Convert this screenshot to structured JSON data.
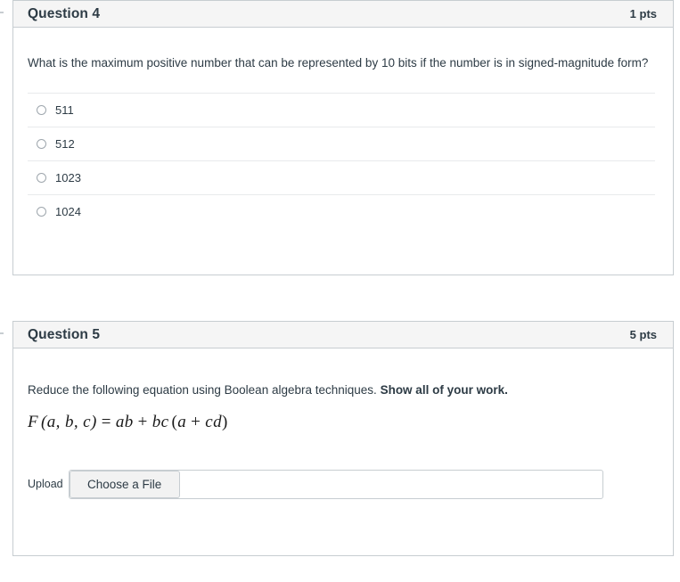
{
  "questions": [
    {
      "title": "Question 4",
      "points": "1 pts",
      "prompt": "What is the maximum positive number that can be represented by 10 bits if the number is in signed-magnitude form?",
      "answers": [
        {
          "label": "511",
          "selected": false
        },
        {
          "label": "512",
          "selected": false
        },
        {
          "label": "1023",
          "selected": false
        },
        {
          "label": "1024",
          "selected": false
        }
      ]
    },
    {
      "title": "Question 5",
      "points": "5 pts",
      "prompt_plain": "Reduce the following equation using Boolean algebra techniques.",
      "prompt_bold": "Show all of your work.",
      "equation": {
        "lhs": "F",
        "args": "(a, b, c)",
        "equals": "=",
        "term1": "ab",
        "plus1": "+",
        "term2": "bc",
        "group_open": "(",
        "term3": "a",
        "plus2": "+",
        "term4": "cd",
        "group_close": ")",
        "full_text": "F (a, b, c)  =  ab  +  bc (a  +  cd)"
      },
      "upload": {
        "label": "Upload",
        "button_label": "Choose a File",
        "file_name": ""
      }
    }
  ],
  "colors": {
    "card_border": "#c7cdd1",
    "header_bg": "#f5f5f5",
    "text": "#2d3b45",
    "separator": "#e8eaec",
    "radio_border": "#9ea6ad",
    "button_bg": "#f2f2f2"
  }
}
